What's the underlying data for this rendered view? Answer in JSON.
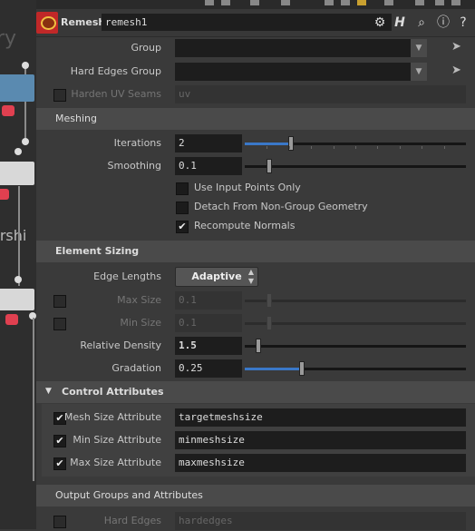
{
  "network_bg": {
    "word1": "ry",
    "word2": "ershi"
  },
  "header": {
    "node_type": "Remesh",
    "node_name": "remesh1",
    "icons": [
      "gear-icon",
      "help-h-icon",
      "search-icon",
      "info-icon",
      "question-icon"
    ]
  },
  "params": {
    "group": {
      "label": "Group",
      "value": ""
    },
    "hard_edges_group": {
      "label": "Hard Edges Group",
      "value": ""
    },
    "harden_uv_seams": {
      "label": "Harden UV Seams",
      "value": "uv",
      "enabled": false
    }
  },
  "meshing": {
    "title": "Meshing",
    "iterations": {
      "label": "Iterations",
      "value": "2",
      "fraction": 0.2
    },
    "smoothing": {
      "label": "Smoothing",
      "value": "0.1",
      "fraction": 0.1
    },
    "use_input_points_only": {
      "label": "Use Input Points Only",
      "checked": false
    },
    "detach": {
      "label": "Detach From Non-Group Geometry",
      "checked": false
    },
    "recompute_normals": {
      "label": "Recompute Normals",
      "checked": true
    }
  },
  "element_sizing": {
    "title": "Element Sizing",
    "edge_lengths": {
      "label": "Edge Lengths",
      "value": "Adaptive"
    },
    "max_size": {
      "label": "Max Size",
      "value": "0.1",
      "fraction": 0.1
    },
    "min_size": {
      "label": "Min Size",
      "value": "0.1",
      "fraction": 0.1
    },
    "relative_density": {
      "label": "Relative Density",
      "value": "1.5",
      "fraction": 0.05
    },
    "gradation": {
      "label": "Gradation",
      "value": "0.25",
      "fraction": 0.25
    }
  },
  "control_attributes": {
    "title": "Control Attributes",
    "mesh_size": {
      "label": "Mesh Size Attribute",
      "value": "targetmeshsize",
      "checked": true
    },
    "min_size": {
      "label": "Min Size Attribute",
      "value": "minmeshsize",
      "checked": true
    },
    "max_size": {
      "label": "Max Size Attribute",
      "value": "maxmeshsize",
      "checked": true
    }
  },
  "output": {
    "title": "Output Groups and Attributes",
    "hard_edges": {
      "label": "Hard Edges",
      "value": "hardedges"
    }
  },
  "colors": {
    "accent": "#3a78c8",
    "panel": "#3a3a3a",
    "field": "#1d1d1d"
  }
}
